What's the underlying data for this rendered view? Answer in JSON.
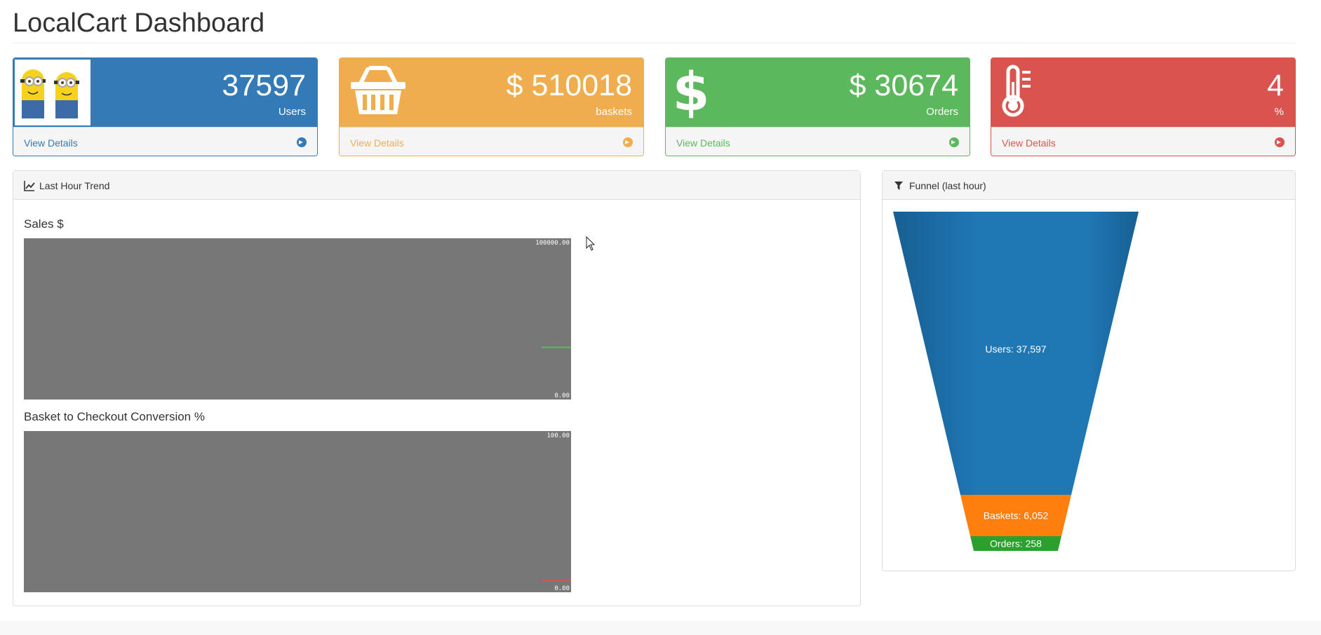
{
  "page": {
    "title": "LocalCart Dashboard"
  },
  "cards": [
    {
      "value": "37597",
      "label": "Users",
      "link": "View Details",
      "icon": "minions-avatar",
      "color": "#337ab7"
    },
    {
      "value": "$ 510018",
      "label": "baskets",
      "link": "View Details",
      "icon": "shopping-basket-icon",
      "color": "#f0ad4e"
    },
    {
      "value": "$ 30674",
      "label": "Orders",
      "link": "View Details",
      "icon": "dollar-icon",
      "color": "#5cb85c"
    },
    {
      "value": "4",
      "label": "%",
      "link": "View Details",
      "icon": "thermometer-icon",
      "color": "#d9534f"
    }
  ],
  "trend_panel": {
    "title": "Last Hour Trend",
    "icon": "line-chart-icon",
    "sales_chart": {
      "title": "Sales $",
      "max_label": "100000.00",
      "min_label": "0.00",
      "line_color": "#5cb85c"
    },
    "conversion_chart": {
      "title": "Basket to Checkout Conversion %",
      "max_label": "100.00",
      "min_label": "0.00",
      "line_color": "#d9534f"
    }
  },
  "funnel_panel": {
    "title": "Funnel (last hour)",
    "icon": "filter-icon"
  },
  "chart_data": [
    {
      "type": "line",
      "title": "Sales $",
      "ylim": [
        0,
        100000
      ],
      "tick_labels": [
        "100000.00",
        "0.00"
      ],
      "series": [
        {
          "values": [
            31000,
            31000
          ]
        }
      ]
    },
    {
      "type": "line",
      "title": "Basket to Checkout Conversion %",
      "ylim": [
        0,
        100
      ],
      "tick_labels": [
        "100.00",
        "0.00"
      ],
      "series": [
        {
          "values": [
            4,
            4
          ]
        }
      ]
    },
    {
      "type": "funnel",
      "categories": [
        "Users",
        "Baskets",
        "Orders"
      ],
      "values": [
        37597,
        6052,
        258
      ],
      "labels": [
        "Users: 37,597",
        "Baskets: 6,052",
        "Orders: 258"
      ],
      "colors": [
        "#1f77b4",
        "#ff7f0e",
        "#2ca02c"
      ]
    }
  ]
}
